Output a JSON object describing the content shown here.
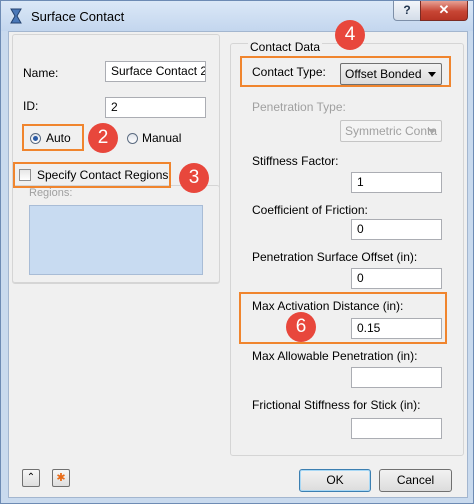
{
  "window": {
    "title": "Surface Contact",
    "help_label": "?",
    "close_label": "✕"
  },
  "left": {
    "name_label": "Name:",
    "name_value": "Surface Contact 2",
    "id_label": "ID:",
    "id_value": "2",
    "auto_label": "Auto",
    "manual_label": "Manual",
    "selected_mode": "Auto",
    "specify_regions_label": "Specify Contact Regions",
    "specify_regions_checked": false,
    "regions_label": "Regions:"
  },
  "contact_data": {
    "group_label": "Contact Data",
    "contact_type_label": "Contact Type:",
    "contact_type_value": "Offset Bonded",
    "penetration_type_label": "Penetration Type:",
    "penetration_type_value": "Symmetric Conta",
    "stiffness_factor_label": "Stiffness Factor:",
    "stiffness_factor_value": "1",
    "friction_label": "Coefficient of Friction:",
    "friction_value": "0",
    "pen_offset_label": "Penetration Surface Offset (in):",
    "pen_offset_value": "0",
    "max_activation_label": "Max Activation Distance (in):",
    "max_activation_value": "0.15",
    "max_allowable_label": "Max Allowable Penetration (in):",
    "max_allowable_value": "",
    "frictional_stiffness_label": "Frictional Stiffness for Stick (in):",
    "frictional_stiffness_value": ""
  },
  "callouts": [
    "2",
    "3",
    "4",
    "6"
  ],
  "footer": {
    "ok_label": "OK",
    "cancel_label": "Cancel",
    "collapse_glyph": "⌃",
    "star_glyph": "✱"
  },
  "colors": {
    "callout": "#e8473c",
    "highlight": "#f0852e",
    "regions_fill": "#c8dbf1",
    "title_bar": "#c9daee"
  }
}
